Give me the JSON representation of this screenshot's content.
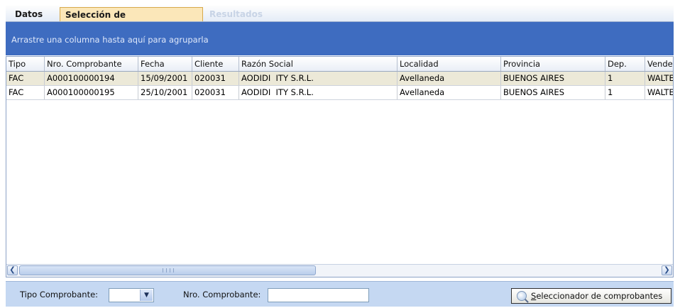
{
  "tabs": [
    {
      "label": "Datos"
    },
    {
      "label": "Selección de comprobantes"
    },
    {
      "label": "Resultados"
    }
  ],
  "group_panel": {
    "hint": "Arrastre una columna hasta aquí para agruparla"
  },
  "grid": {
    "columns": [
      "Tipo",
      "Nro. Comprobante",
      "Fecha",
      "Cliente",
      "Razón Social",
      "Localidad",
      "Provincia",
      "Dep.",
      "Vended"
    ],
    "rows": [
      [
        "FAC",
        "A000100000194",
        "15/09/2001",
        "020031",
        "AODIDI  ITY S.R.L.",
        "Avellaneda",
        "BUENOS AIRES",
        "1",
        "WALTE"
      ],
      [
        "FAC",
        "A000100000195",
        "25/10/2001",
        "020031",
        "AODIDI  ITY S.R.L.",
        "Avellaneda",
        "BUENOS AIRES",
        "1",
        "WALTE"
      ]
    ]
  },
  "filter": {
    "tipo_label": "Tipo Comprobante:",
    "tipo_value": "",
    "nro_label": "Nro. Comprobante:",
    "nro_value": "",
    "button_first_letter": "S",
    "button_rest": "eleccionador de comprobantes"
  },
  "colors": {
    "accent": "#3e6cc0",
    "selected_row": "#ece9d8",
    "active_tab": "#fbe7b9"
  }
}
